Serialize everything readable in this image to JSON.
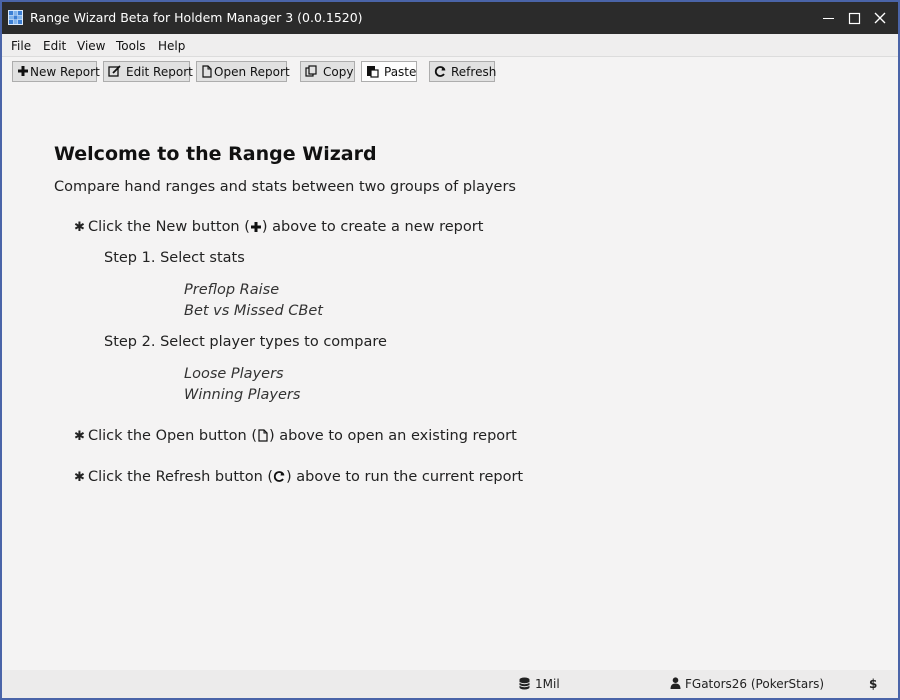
{
  "window": {
    "title": "Range Wizard Beta for Holdem Manager 3 (0.0.1520)"
  },
  "menu": [
    "File",
    "Edit",
    "View",
    "Tools",
    "Help"
  ],
  "toolbar": {
    "new_report": "New Report",
    "edit_report": "Edit Report",
    "open_report": "Open Report",
    "copy": "Copy",
    "paste": "Paste",
    "refresh": "Refresh"
  },
  "content": {
    "heading": "Welcome to the Range Wizard",
    "subtitle": "Compare hand ranges and stats between two groups of players",
    "bullet_new_before": "Click the New button (",
    "bullet_new_after": ") above to create a new report",
    "step1": "Step 1. Select stats",
    "stats": [
      "Preflop Raise",
      "Bet vs Missed CBet"
    ],
    "step2": "Step 2. Select player types to compare",
    "player_types": [
      "Loose Players",
      "Winning Players"
    ],
    "bullet_open_before": "Click the Open button (",
    "bullet_open_after": ") above to open an existing report",
    "bullet_refresh_before": "Click the Refresh button (",
    "bullet_refresh_after": ") above to run the current report"
  },
  "status": {
    "database": "1Mil",
    "player": "FGators26 (PokerStars)",
    "currency": "$"
  },
  "icons": {
    "app": "app-grid-icon",
    "new": "plus-icon",
    "edit": "edit-icon",
    "open": "file-icon",
    "copy": "copy-icon",
    "paste": "paste-icon",
    "refresh": "refresh-icon",
    "database": "database-icon",
    "user": "user-icon"
  },
  "colors": {
    "titlebar": "#2b2b2b",
    "border": "#4a64a8",
    "background": "#f4f3f3",
    "app_icon": "#3c7fd4"
  }
}
